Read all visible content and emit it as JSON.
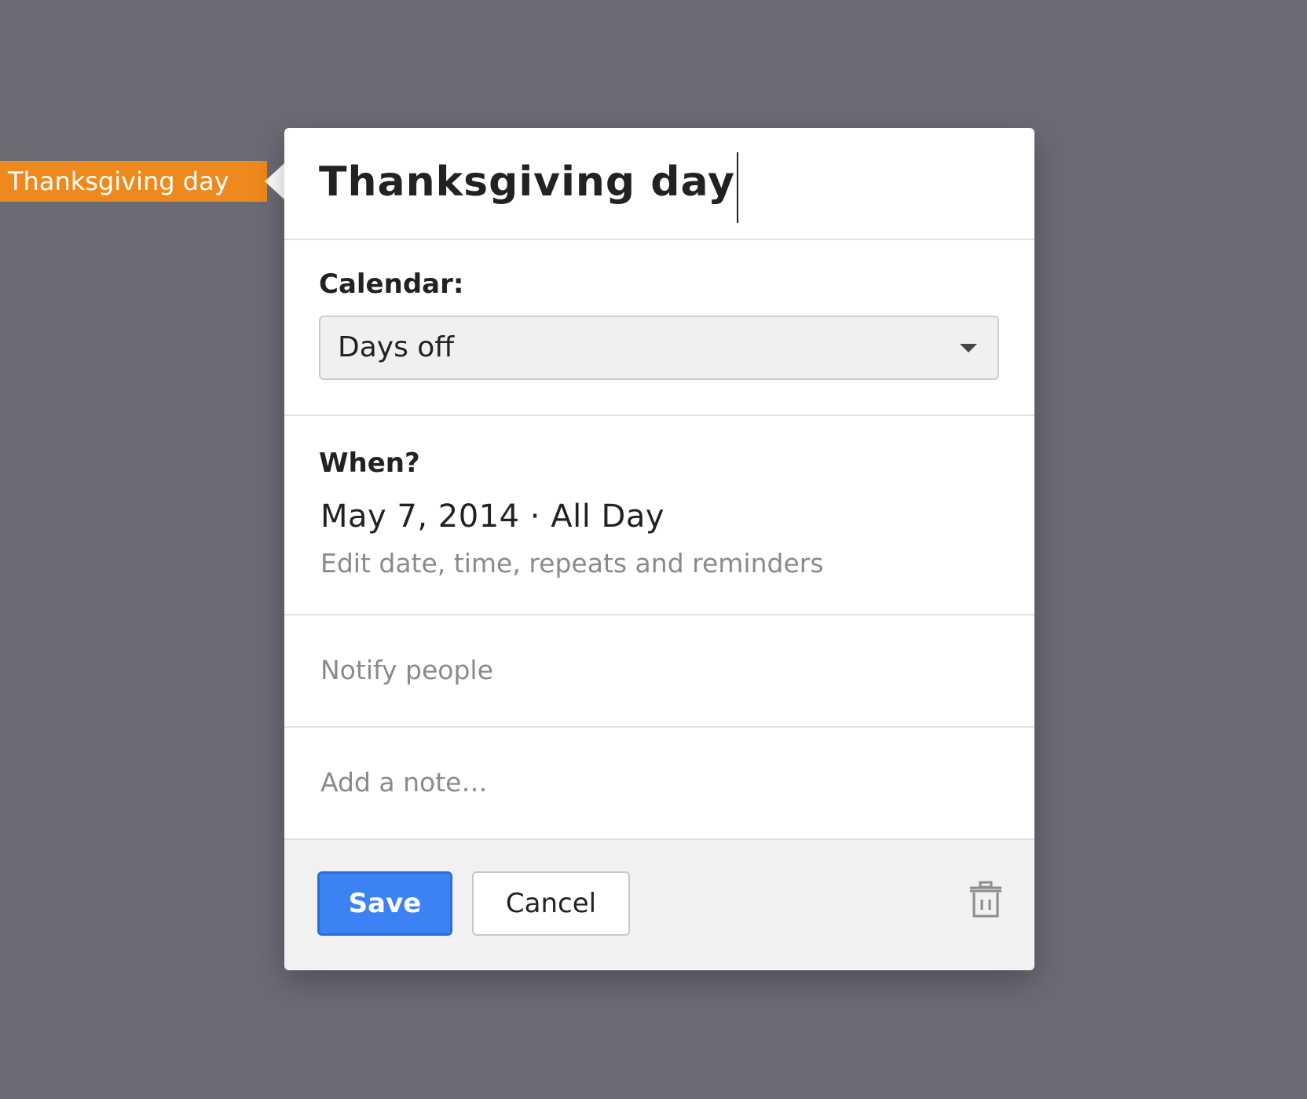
{
  "event_tag": {
    "label": "Thanksgiving day"
  },
  "dialog": {
    "title": "Thanksgiving day",
    "calendar": {
      "label": "Calendar:",
      "selected": "Days off"
    },
    "when": {
      "label": "When?",
      "value": "May 7, 2014 · All Day",
      "edit_link": "Edit date, time, repeats and reminders"
    },
    "notify": {
      "placeholder": "Notify people"
    },
    "note": {
      "placeholder": "Add a note…"
    },
    "footer": {
      "save_label": "Save",
      "cancel_label": "Cancel",
      "delete_icon": "trash-icon"
    }
  },
  "colors": {
    "background": "#6b6b75",
    "event_tag": "#ee8a1d",
    "primary_button": "#3d82f5",
    "footer": "#f1f1f1"
  }
}
